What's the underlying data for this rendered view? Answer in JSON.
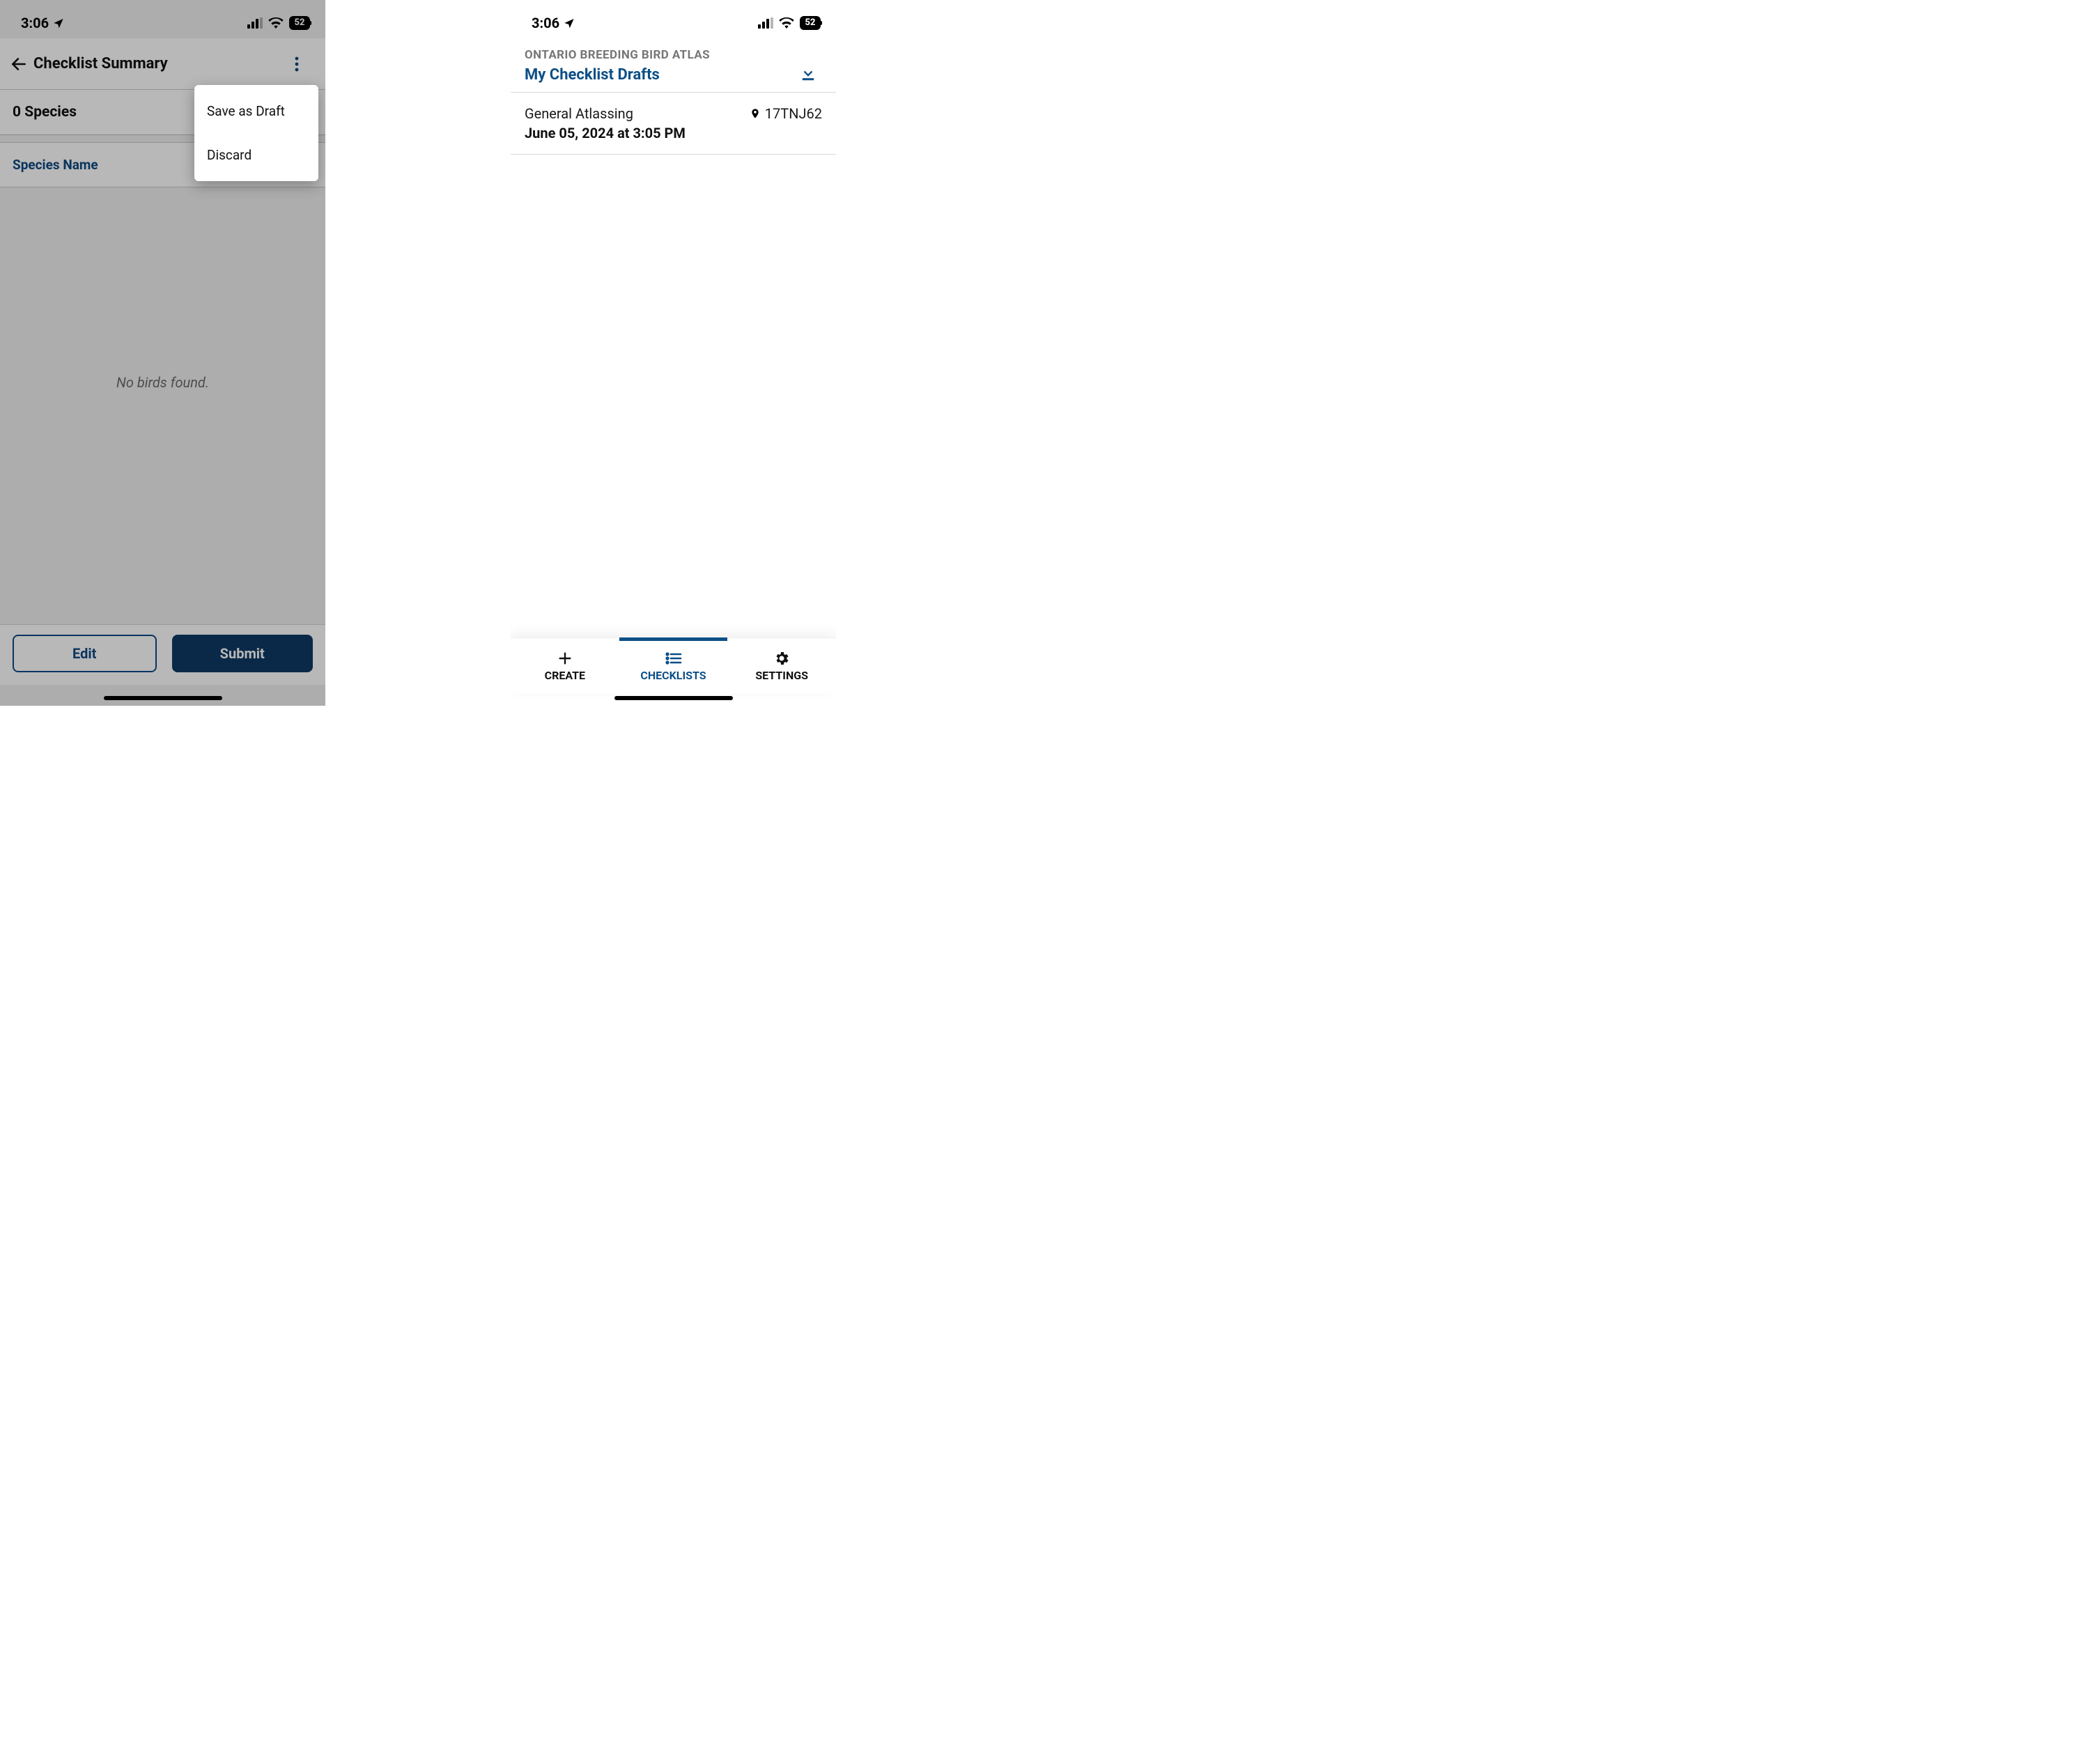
{
  "status": {
    "time": "3:06",
    "battery": "52"
  },
  "left": {
    "title": "Checklist Summary",
    "species_header": "0 Species",
    "species_name_header": "Species Name",
    "empty_text": "No birds found.",
    "edit_label": "Edit",
    "submit_label": "Submit",
    "menu": {
      "save_draft": "Save as Draft",
      "discard": "Discard"
    }
  },
  "right": {
    "atlas_label": "ONTARIO BREEDING BIRD ATLAS",
    "drafts_title": "My Checklist Drafts",
    "draft": {
      "type": "General Atlassing",
      "location_code": "17TNJ62",
      "datetime": "June 05, 2024 at 3:05 PM"
    },
    "nav": {
      "create": "CREATE",
      "checklists": "CHECKLISTS",
      "settings": "SETTINGS"
    }
  }
}
